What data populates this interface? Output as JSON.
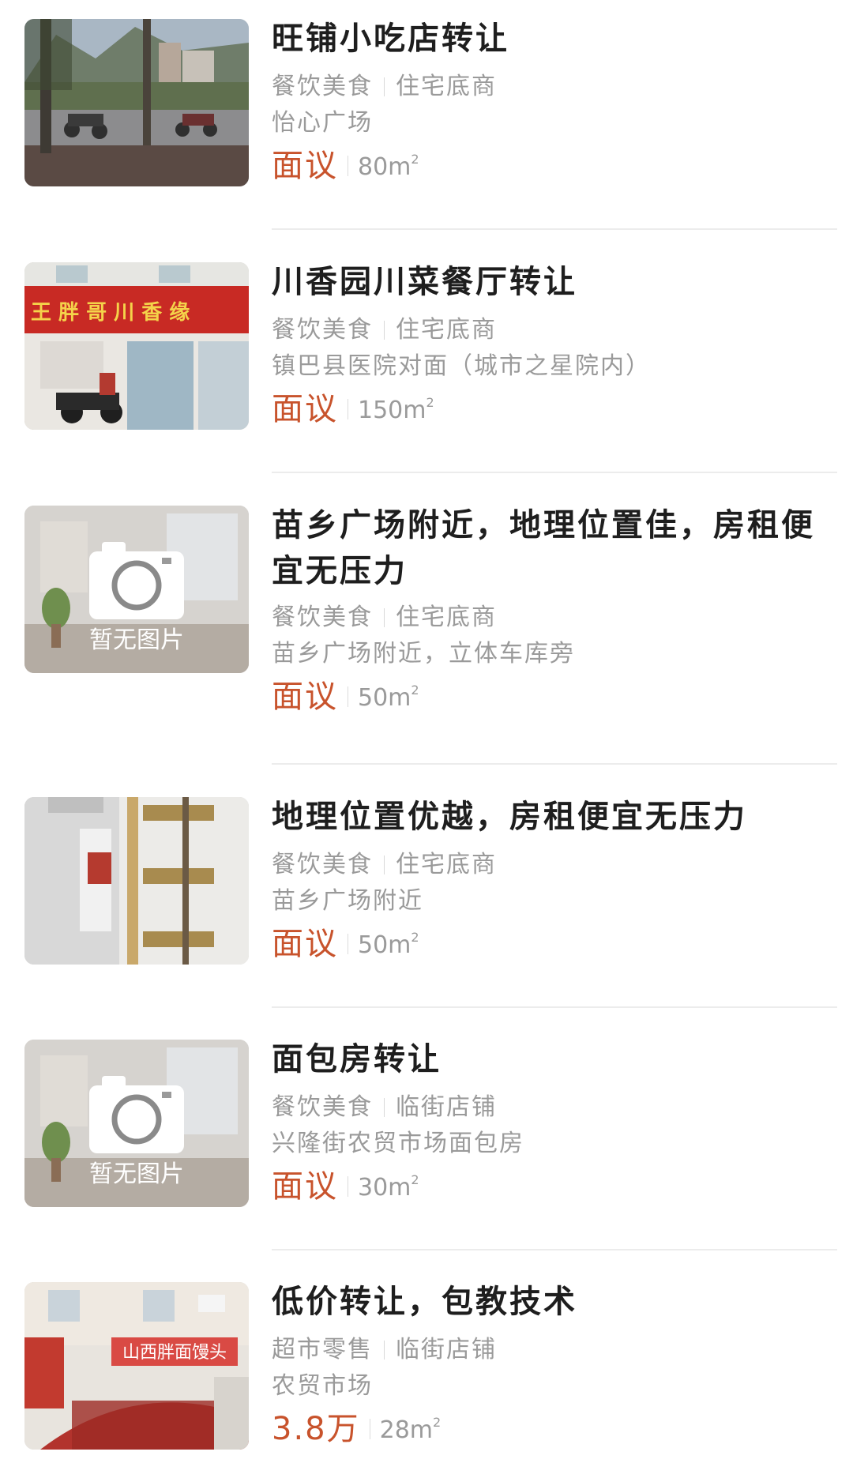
{
  "listings": [
    {
      "title": "旺铺小吃店转让",
      "tag1": "餐饮美食",
      "tag2": "住宅底商",
      "address": "怡心广场",
      "price": "面议",
      "area": "80m",
      "area_sup": "2",
      "thumbnail": "street-photo"
    },
    {
      "title": "川香园川菜餐厅转让",
      "tag1": "餐饮美食",
      "tag2": "住宅底商",
      "address": "镇巴县医院对面（城市之星院内）",
      "price": "面议",
      "area": "150m",
      "area_sup": "2",
      "thumbnail": "storefront-photo",
      "sign_text": "王 胖 哥    川 香 缘"
    },
    {
      "title": "苗乡广场附近，地理位置佳，房租便宜无压力",
      "tag1": "餐饮美食",
      "tag2": "住宅底商",
      "address": "苗乡广场附近，立体车库旁",
      "price": "面议",
      "area": "50m",
      "area_sup": "2",
      "thumbnail": "no-image",
      "noimage_text": "暂无图片"
    },
    {
      "title": "地理位置优越，房租便宜无压力",
      "tag1": "餐饮美食",
      "tag2": "住宅底商",
      "address": "苗乡广场附近",
      "price": "面议",
      "area": "50m",
      "area_sup": "2",
      "thumbnail": "interior-photo"
    },
    {
      "title": "面包房转让",
      "tag1": "餐饮美食",
      "tag2": "临街店铺",
      "address": "兴隆街农贸市场面包房",
      "price": "面议",
      "area": "30m",
      "area_sup": "2",
      "thumbnail": "no-image",
      "noimage_text": "暂无图片"
    },
    {
      "title": "低价转让，包教技术",
      "tag1": "超市零售",
      "tag2": "临街店铺",
      "address": "农贸市场",
      "price": "3.8万",
      "area": "28m",
      "area_sup": "2",
      "thumbnail": "shop-photo",
      "sign_text": "山西胖面馒头"
    }
  ],
  "colors": {
    "price": "#c8532c",
    "title": "#1e1e1e",
    "meta": "#9a9a9a",
    "divider": "#ececec"
  }
}
